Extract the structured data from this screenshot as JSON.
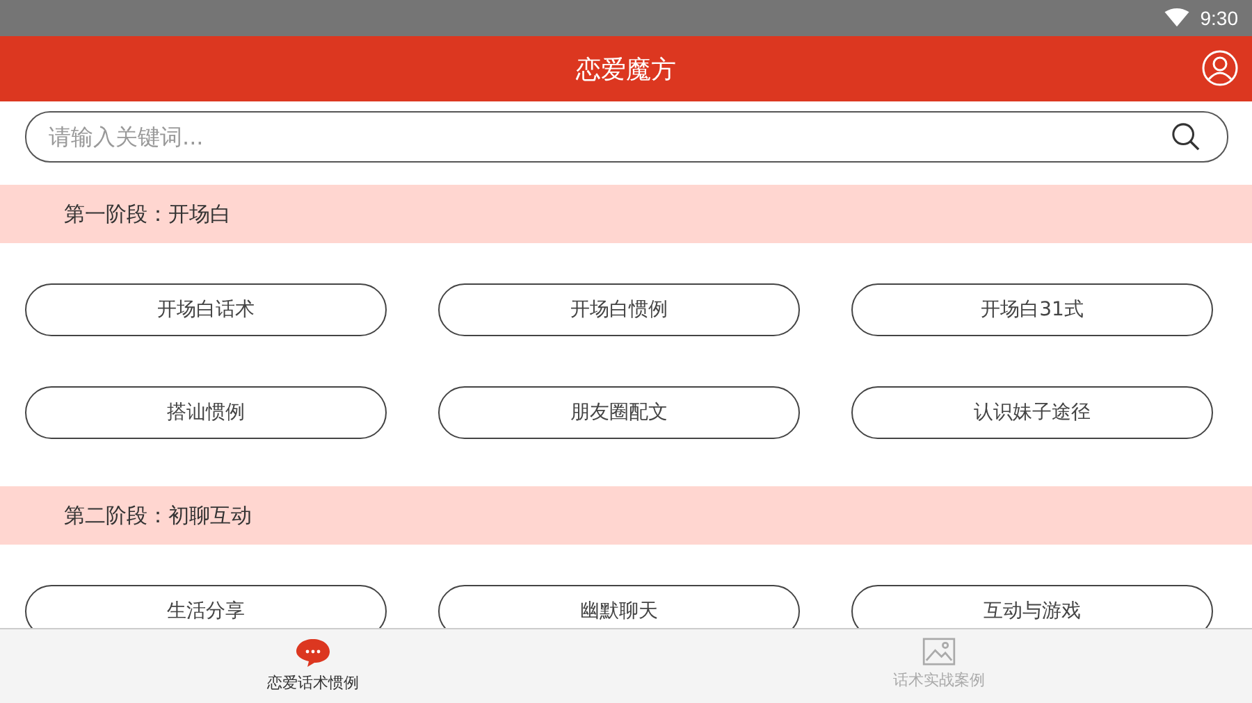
{
  "status_bar": {
    "time": "9:30"
  },
  "header": {
    "title": "恋爱魔方"
  },
  "search": {
    "placeholder": "请输入关键词..."
  },
  "sections": [
    {
      "title": "第一阶段：开场白",
      "items": [
        "开场白话术",
        "开场白惯例",
        "开场白31式",
        "搭讪惯例",
        "朋友圈配文",
        "认识妹子途径"
      ]
    },
    {
      "title": "第二阶段：初聊互动",
      "items": [
        "生活分享",
        "幽默聊天",
        "互动与游戏"
      ]
    }
  ],
  "bottom_nav": [
    {
      "label": "恋爱话术惯例",
      "kind": "chat",
      "selected": true
    },
    {
      "label": "话术实战案例",
      "kind": "image",
      "selected": false
    }
  ]
}
